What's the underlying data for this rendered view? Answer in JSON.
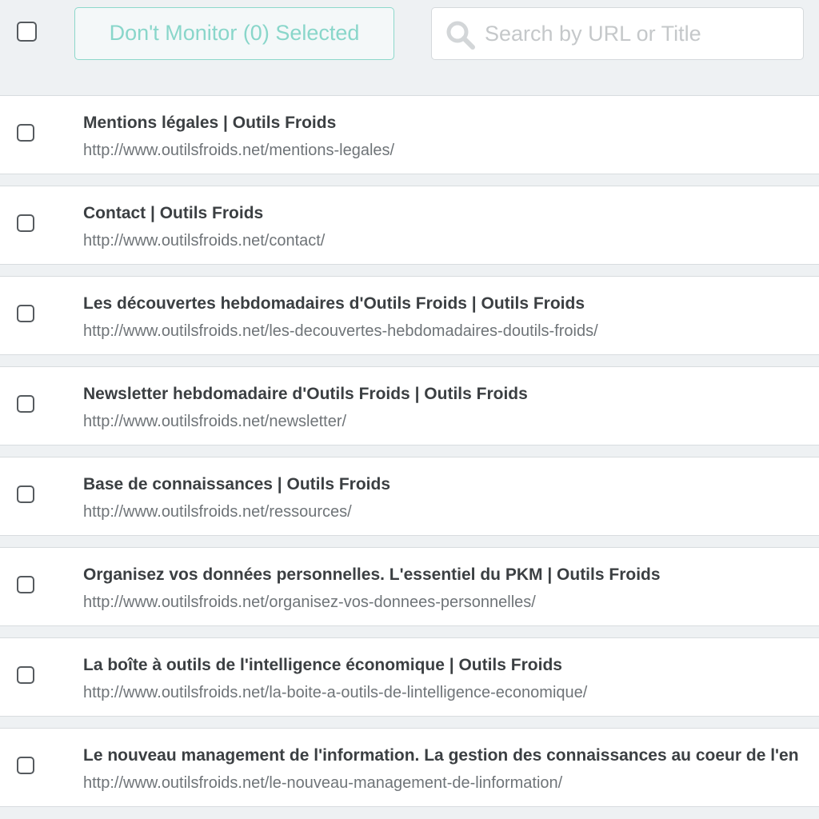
{
  "toolbar": {
    "action_button_label": "Don't Monitor (0) Selected",
    "search_placeholder": "Search by URL or Title",
    "search_value": ""
  },
  "pages": [
    {
      "title": "Mentions légales | Outils Froids",
      "url": "http://www.outilsfroids.net/mentions-legales/"
    },
    {
      "title": "Contact | Outils Froids",
      "url": "http://www.outilsfroids.net/contact/"
    },
    {
      "title": "Les découvertes hebdomadaires d'Outils Froids | Outils Froids",
      "url": "http://www.outilsfroids.net/les-decouvertes-hebdomadaires-doutils-froids/"
    },
    {
      "title": "Newsletter hebdomadaire d'Outils Froids | Outils Froids",
      "url": "http://www.outilsfroids.net/newsletter/"
    },
    {
      "title": "Base de connaissances | Outils Froids",
      "url": "http://www.outilsfroids.net/ressources/"
    },
    {
      "title": "Organisez vos données personnelles. L'essentiel du PKM | Outils Froids",
      "url": "http://www.outilsfroids.net/organisez-vos-donnees-personnelles/"
    },
    {
      "title": "La boîte à outils de l'intelligence économique | Outils Froids",
      "url": "http://www.outilsfroids.net/la-boite-a-outils-de-lintelligence-economique/"
    },
    {
      "title": "Le nouveau management de l'information. La gestion des connaissances au coeur de l'en",
      "url": "http://www.outilsfroids.net/le-nouveau-management-de-linformation/"
    }
  ],
  "colors": {
    "accent": "#8dd8cb",
    "background": "#eef1f3"
  }
}
